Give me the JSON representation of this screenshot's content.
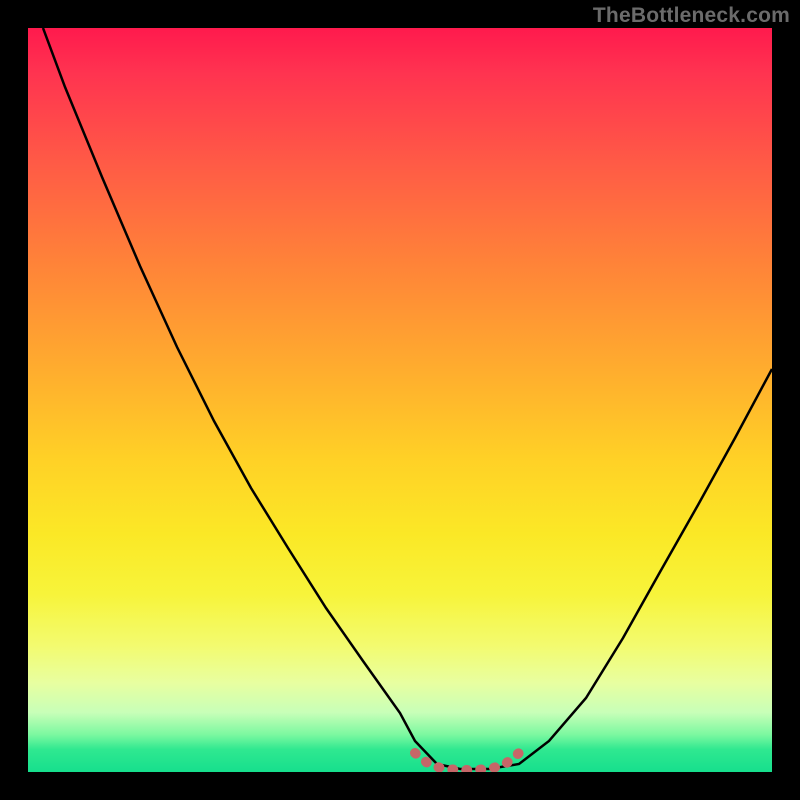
{
  "watermark": {
    "text": "TheBottleneck.com"
  },
  "colors": {
    "frame": "#000000",
    "gradient_top": "#ff1a4d",
    "gradient_bottom": "#16df8d",
    "curve_stroke": "#000000",
    "flat_segment": "#c66668"
  },
  "chart_data": {
    "type": "line",
    "title": "",
    "xlabel": "",
    "ylabel": "",
    "xlim": [
      0,
      100
    ],
    "ylim": [
      0,
      100
    ],
    "grid": false,
    "legend": false,
    "series": [
      {
        "name": "bottleneck-curve",
        "color": "#000000",
        "x": [
          2,
          5,
          10,
          15,
          20,
          25,
          30,
          35,
          40,
          45,
          50,
          52,
          55,
          58,
          62,
          66,
          70,
          75,
          80,
          85,
          90,
          95,
          100
        ],
        "y": [
          100,
          92,
          80,
          68,
          57,
          47,
          38,
          30,
          22,
          15,
          8,
          4,
          1,
          0.4,
          0.4,
          1,
          4,
          10,
          18,
          27,
          36,
          45,
          54
        ]
      },
      {
        "name": "optimal-flat-segment",
        "color": "#c66668",
        "x": [
          52,
          54,
          56,
          58,
          60,
          62,
          64,
          66
        ],
        "y": [
          2.5,
          0.9,
          0.4,
          0.3,
          0.3,
          0.4,
          0.9,
          2.5
        ]
      }
    ]
  }
}
